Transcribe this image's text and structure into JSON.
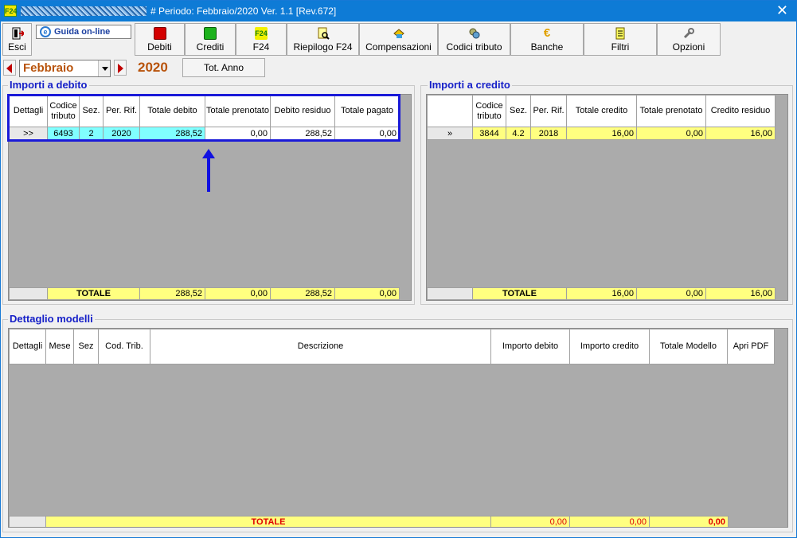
{
  "titlebar": {
    "title": "# Periodo: Febbraio/2020 Ver. 1.1 [Rev.672]",
    "app_icon": "F24",
    "close": "✕"
  },
  "toolbar": {
    "esci": "Esci",
    "guida": "Guida on-line",
    "guida_icon": "e",
    "debiti": "Debiti",
    "crediti": "Crediti",
    "f24": "F24",
    "riepilogo": "Riepilogo F24",
    "compensazioni": "Compensazioni",
    "codici": "Codici tributo",
    "banche": "Banche",
    "filtri": "Filtri",
    "opzioni": "Opzioni"
  },
  "nav": {
    "month": "Febbraio",
    "year": "2020",
    "tot_anno": "Tot. Anno"
  },
  "debito": {
    "title": "Importi a debito",
    "headers": [
      "Dettagli",
      "Codice tributo",
      "Sez.",
      "Per. Rif.",
      "Totale debito",
      "Totale prenotato",
      "Debito residuo",
      "Totale pagato"
    ],
    "rows": [
      [
        ">>",
        "6493",
        "2",
        "2020",
        "288,52",
        "0,00",
        "288,52",
        "0,00"
      ]
    ],
    "totals": {
      "label": "TOTALE",
      "debito": "288,52",
      "prenotato": "0,00",
      "residuo": "288,52",
      "pagato": "0,00"
    }
  },
  "credito": {
    "title": "Importi a credito",
    "headers": [
      "",
      "Codice tributo",
      "Sez.",
      "Per. Rif.",
      "Totale credito",
      "Totale prenotato",
      "Credito residuo"
    ],
    "rows": [
      [
        "»",
        "3844",
        "4.2",
        "2018",
        "16,00",
        "0,00",
        "16,00"
      ]
    ],
    "totals": {
      "label": "TOTALE",
      "credito": "16,00",
      "prenotato": "0,00",
      "residuo": "16,00"
    }
  },
  "modelli": {
    "title": "Dettaglio modelli",
    "headers": [
      "Dettagli",
      "Mese",
      "Sez",
      "Cod. Trib.",
      "Descrizione",
      "Importo debito",
      "Importo credito",
      "Totale Modello",
      "Apri PDF"
    ],
    "totals": {
      "label": "TOTALE",
      "debito": "0,00",
      "credito": "0,00",
      "modello": "0,00"
    }
  },
  "colors": {
    "title_bar": "#0e7bd6",
    "group_title": "#1620c8",
    "selected_row": "#80ffff",
    "total_row": "#ffff80",
    "highlight_box": "#1a1ad8"
  }
}
